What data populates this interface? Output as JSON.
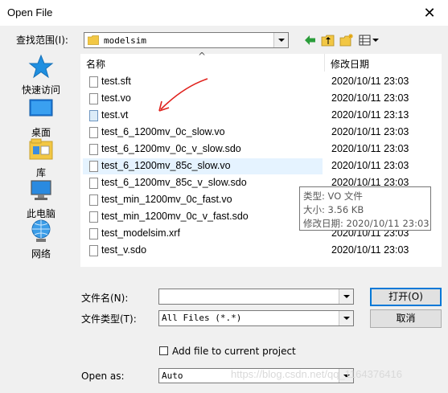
{
  "window": {
    "title": "Open File",
    "close_glyph": "✕"
  },
  "lookin": {
    "label": "查找范围(I):",
    "value": "modelsim"
  },
  "toolbar": {
    "icons": [
      "back-arrow-icon",
      "up-folder-icon",
      "new-folder-icon",
      "view-menu-icon"
    ]
  },
  "places": [
    {
      "label": "快速访问",
      "icon": "quick-access-star-icon"
    },
    {
      "label": "桌面",
      "icon": "desktop-icon"
    },
    {
      "label": "库",
      "icon": "library-icon"
    },
    {
      "label": "此电脑",
      "icon": "this-pc-icon"
    },
    {
      "label": "网络",
      "icon": "network-icon"
    }
  ],
  "filelist": {
    "col_name": "名称",
    "col_date": "修改日期",
    "sort_glyph": "^",
    "files": [
      {
        "name": "test.sft",
        "date": "2020/10/11 23:03",
        "icon": "file-icon"
      },
      {
        "name": "test.vo",
        "date": "2020/10/11 23:03",
        "icon": "file-icon"
      },
      {
        "name": "test.vt",
        "date": "2020/10/11 23:13",
        "icon": "vt-file-icon"
      },
      {
        "name": "test_6_1200mv_0c_slow.vo",
        "date": "2020/10/11 23:03",
        "icon": "file-icon"
      },
      {
        "name": "test_6_1200mv_0c_v_slow.sdo",
        "date": "2020/10/11 23:03",
        "icon": "file-icon"
      },
      {
        "name": "test_6_1200mv_85c_slow.vo",
        "date": "2020/10/11 23:03",
        "icon": "file-icon"
      },
      {
        "name": "test_6_1200mv_85c_v_slow.sdo",
        "date": "2020/10/11 23:03",
        "icon": "file-icon"
      },
      {
        "name": "test_min_1200mv_0c_fast.vo",
        "date": "",
        "icon": "file-icon"
      },
      {
        "name": "test_min_1200mv_0c_v_fast.sdo",
        "date": "",
        "icon": "file-icon"
      },
      {
        "name": "test_modelsim.xrf",
        "date": "2020/10/11 23:03",
        "icon": "file-icon"
      },
      {
        "name": "test_v.sdo",
        "date": "2020/10/11 23:03",
        "icon": "file-icon"
      }
    ],
    "hovered_row": 5
  },
  "tooltip": {
    "line1": "类型: VO 文件",
    "line2": "大小: 3.56 KB",
    "line3": "修改日期: 2020/10/11 23:03"
  },
  "form": {
    "filename_label": "文件名(N):",
    "filename_value": "",
    "filetype_label": "文件类型(T):",
    "filetype_value": "All Files (*.*)",
    "open_label": "打开(O)",
    "cancel_label": "取消",
    "add_to_project_label": "Add file to current project",
    "add_to_project_checked": false,
    "open_as_label": "Open as:",
    "open_as_value": "Auto"
  },
  "watermark": "https://blog.csdn.net/qq_1164376416",
  "colors": {
    "annotation_arrow": "#e0211c",
    "hover_row": "#e5f3ff",
    "default_button_border": "#0078d7",
    "toolbar_back_arrow": "#2a9d3a",
    "folder_yellow": "#f2c744"
  }
}
